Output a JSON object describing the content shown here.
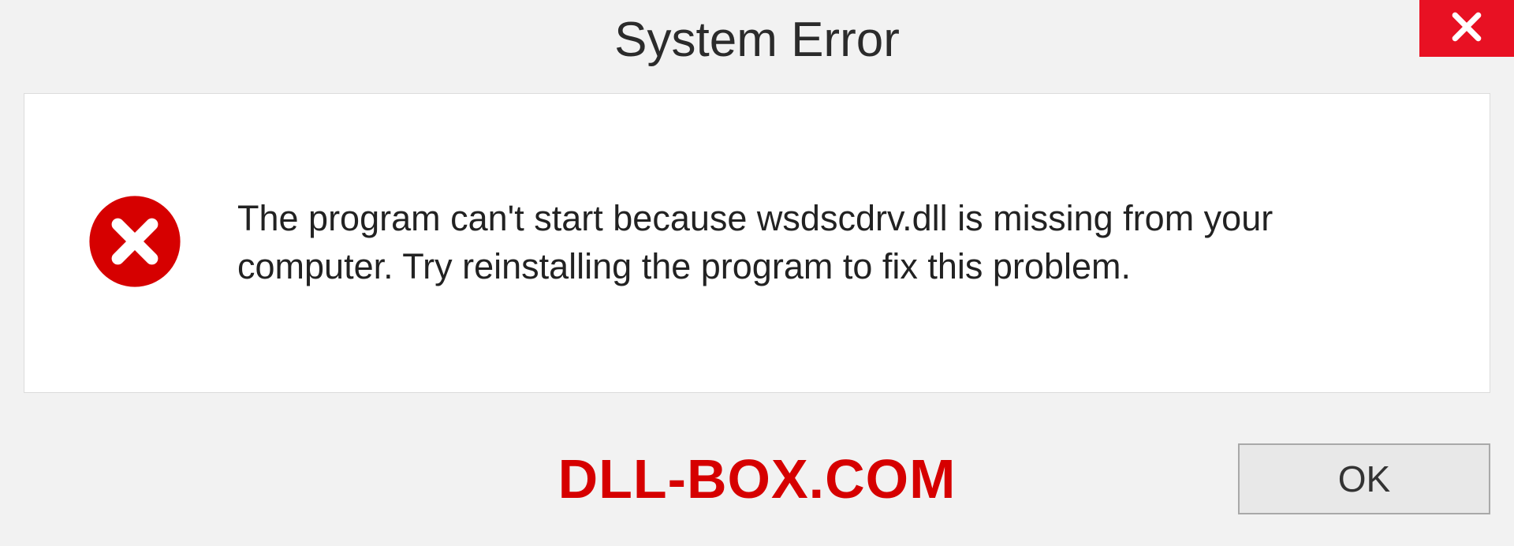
{
  "titlebar": {
    "title": "System Error"
  },
  "message": {
    "text": "The program can't start because wsdscdrv.dll is missing from your computer. Try reinstalling the program to fix this problem."
  },
  "footer": {
    "watermark": "DLL-BOX.COM",
    "ok_label": "OK"
  },
  "colors": {
    "close_red": "#e81123",
    "error_red": "#d60000"
  }
}
